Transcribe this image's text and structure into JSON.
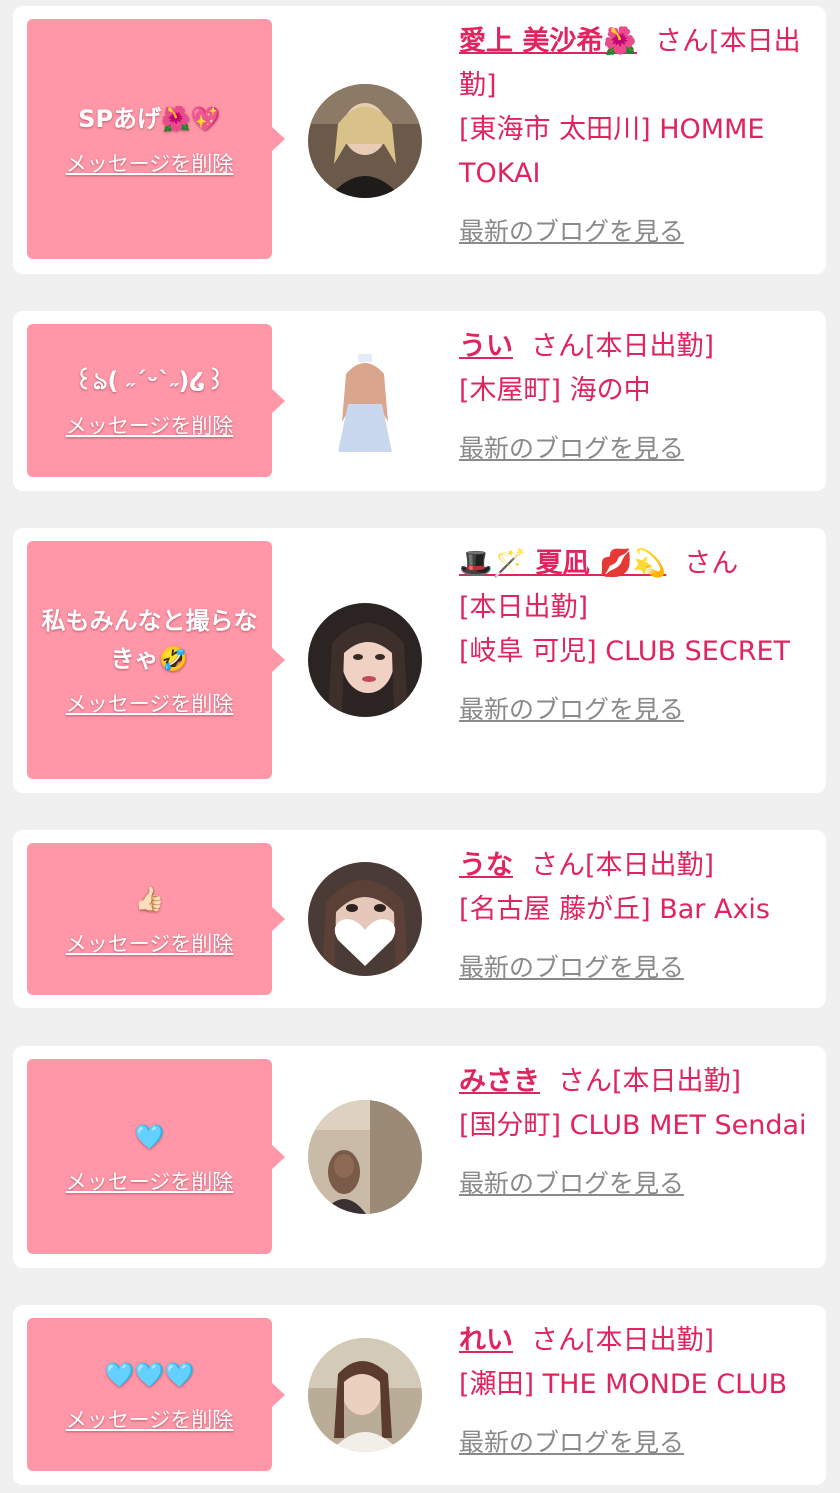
{
  "common": {
    "delete_label": "メッセージを削除",
    "blog_label": "最新のブログを見る",
    "san": "さん"
  },
  "colors": {
    "bubble": "#ff97a8",
    "accent": "#e0245e",
    "link_gray": "#8a8a8a",
    "card_bg": "#ffffff",
    "page_bg": "#f0f0f0"
  },
  "items": [
    {
      "message": "SPあげ🌺💖",
      "name": "愛上 美沙希🌺",
      "status": "[本日出勤]",
      "location": "[東海市 太田川] HOMME TOKAI"
    },
    {
      "message": "꒰ঌ( ˶ˊᵕˋ˶)໒꒱",
      "name": "うい",
      "status": "[本日出勤]",
      "location": "[木屋町] 海の中"
    },
    {
      "message": "私もみんなと撮らなきゃ🤣",
      "name": "🎩🪄 夏凪 💋💫",
      "status": "[本日出勤]",
      "location": "[岐阜 可児] CLUB SECRET"
    },
    {
      "message": "👍🏻",
      "name": "うな",
      "status": "[本日出勤]",
      "location": "[名古屋 藤が丘] Bar Axis"
    },
    {
      "message": "🩵",
      "name": "みさき",
      "status": "[本日出勤]",
      "location": "[国分町] CLUB MET Sendai"
    },
    {
      "message": "🩵🩵🩵",
      "name": "れい",
      "status": "[本日出勤]",
      "location": "[瀬田] THE MONDE CLUB"
    }
  ]
}
